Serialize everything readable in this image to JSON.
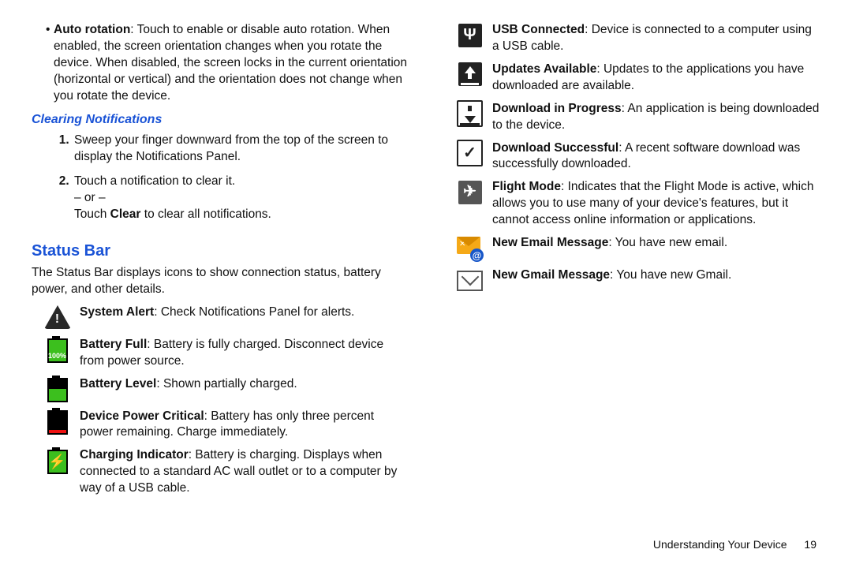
{
  "left": {
    "auto_rotation": {
      "label": "Auto rotation",
      "text": ": Touch to enable or disable auto rotation. When enabled, the screen orientation changes when you rotate the device. When disabled, the screen locks in the current orientation (horizontal or vertical) and the orientation does not change when you rotate the device."
    },
    "clearing_heading": "Clearing Notifications",
    "step1": "Sweep your finger downward from the top of the screen to display the Notifications Panel.",
    "step2a": "Touch a notification to clear it.",
    "step2_or": "– or –",
    "step2b_pre": "Touch ",
    "step2b_bold": "Clear",
    "step2b_post": " to clear all notifications.",
    "status_heading": "Status Bar",
    "status_intro": "The Status Bar displays icons to show connection status, battery power, and other details."
  },
  "icons": {
    "alert": {
      "title": "System Alert",
      "text": ": Check Notifications Panel for alerts."
    },
    "batt_full": {
      "title": "Battery Full",
      "text": ": Battery is fully charged. Disconnect device from power source."
    },
    "batt_level": {
      "title": "Battery Level",
      "text": ": Shown partially charged."
    },
    "batt_crit": {
      "title": "Device Power Critical",
      "text": ": Battery has only three percent power remaining. Charge immediately."
    },
    "charging": {
      "title": "Charging Indicator",
      "text": ": Battery is charging. Displays when connected to a standard AC wall outlet or to a computer by way of a USB cable."
    },
    "usb": {
      "title": "USB Connected",
      "text": ": Device is connected to a computer using a USB cable."
    },
    "updates": {
      "title": "Updates Available",
      "text": ": Updates to the applications you have downloaded are available."
    },
    "dl_prog": {
      "title": "Download in Progress",
      "text": ": An application is being downloaded to the device."
    },
    "dl_ok": {
      "title": "Download Successful",
      "text": ": A recent software download was successfully downloaded."
    },
    "flight": {
      "title": "Flight Mode",
      "text": ": Indicates that the Flight Mode is active, which allows you to use many of your device's features, but it cannot access online information or applications."
    },
    "email": {
      "title": "New Email Message",
      "text": ": You have new email."
    },
    "gmail": {
      "title": "New Gmail Message",
      "text": ": You have new Gmail."
    }
  },
  "footer": {
    "chapter": "Understanding Your Device",
    "page": "19"
  },
  "glyph": {
    "usb": "Ψ",
    "check": "✓",
    "plane": "✈",
    "at": "@"
  }
}
